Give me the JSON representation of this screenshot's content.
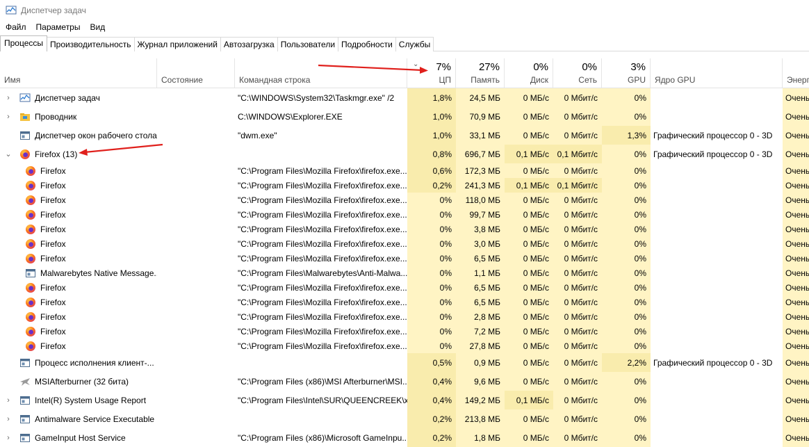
{
  "window": {
    "title": "Диспетчер задач"
  },
  "menu": [
    "Файл",
    "Параметры",
    "Вид"
  ],
  "tabs": [
    "Процессы",
    "Производительность",
    "Журнал приложений",
    "Автозагрузка",
    "Пользователи",
    "Подробности",
    "Службы"
  ],
  "header": {
    "name": "Имя",
    "state": "Состояние",
    "cmd": "Командная строка",
    "cpu_pct": "7%",
    "cpu": "ЦП",
    "mem_pct": "27%",
    "mem": "Память",
    "disk_pct": "0%",
    "disk": "Диск",
    "net_pct": "0%",
    "net": "Сеть",
    "gpu_pct": "3%",
    "gpu": "GPU",
    "engine": "Ядро GPU",
    "power": "Энерг"
  },
  "rows": [
    {
      "exp": "›",
      "icon": "taskmgr-icon",
      "name": "Диспетчер задач",
      "cmd": "\"C:\\WINDOWS\\System32\\Taskmgr.exe\" /2",
      "cpu": "1,8%",
      "mem": "24,5 МБ",
      "disk": "0 МБ/с",
      "net": "0 Мбит/с",
      "gpu": "0%",
      "engine": "",
      "power": "Очень"
    },
    {
      "exp": "›",
      "icon": "explorer-icon",
      "name": "Проводник",
      "cmd": "C:\\WINDOWS\\Explorer.EXE",
      "cpu": "1,0%",
      "mem": "70,9 МБ",
      "disk": "0 МБ/с",
      "net": "0 Мбит/с",
      "gpu": "0%",
      "engine": "",
      "power": "Очень"
    },
    {
      "exp": "",
      "icon": "window-icon",
      "name": "Диспетчер окон рабочего стола",
      "cmd": "\"dwm.exe\"",
      "cpu": "1,0%",
      "mem": "33,1 МБ",
      "disk": "0 МБ/с",
      "net": "0 Мбит/с",
      "gpu": "1,3%",
      "engine": "Графический процессор 0 - 3D",
      "power": "Очень"
    },
    {
      "exp": "⌄",
      "icon": "firefox-icon",
      "name": "Firefox (13)",
      "cmd": "",
      "cpu": "0,8%",
      "mem": "696,7 МБ",
      "disk": "0,1 МБ/с",
      "net": "0,1 Мбит/с",
      "gpu": "0%",
      "engine": "Графический процессор 0 - 3D",
      "power": "Очень"
    },
    {
      "child": true,
      "icon": "firefox-icon",
      "name": "Firefox",
      "cmd": "\"C:\\Program Files\\Mozilla Firefox\\firefox.exe...",
      "cpu": "0,6%",
      "mem": "172,3 МБ",
      "disk": "0 МБ/с",
      "net": "0 Мбит/с",
      "gpu": "0%",
      "engine": "",
      "power": "Очень"
    },
    {
      "child": true,
      "icon": "firefox-icon",
      "name": "Firefox",
      "cmd": "\"C:\\Program Files\\Mozilla Firefox\\firefox.exe...",
      "cpu": "0,2%",
      "mem": "241,3 МБ",
      "disk": "0,1 МБ/с",
      "net": "0,1 Мбит/с",
      "gpu": "0%",
      "engine": "",
      "power": "Очень"
    },
    {
      "child": true,
      "icon": "firefox-icon",
      "name": "Firefox",
      "cmd": "\"C:\\Program Files\\Mozilla Firefox\\firefox.exe...",
      "cpu": "0%",
      "mem": "118,0 МБ",
      "disk": "0 МБ/с",
      "net": "0 Мбит/с",
      "gpu": "0%",
      "engine": "",
      "power": "Очень"
    },
    {
      "child": true,
      "icon": "firefox-icon",
      "name": "Firefox",
      "cmd": "\"C:\\Program Files\\Mozilla Firefox\\firefox.exe...",
      "cpu": "0%",
      "mem": "99,7 МБ",
      "disk": "0 МБ/с",
      "net": "0 Мбит/с",
      "gpu": "0%",
      "engine": "",
      "power": "Очень"
    },
    {
      "child": true,
      "icon": "firefox-icon",
      "name": "Firefox",
      "cmd": "\"C:\\Program Files\\Mozilla Firefox\\firefox.exe...",
      "cpu": "0%",
      "mem": "3,8 МБ",
      "disk": "0 МБ/с",
      "net": "0 Мбит/с",
      "gpu": "0%",
      "engine": "",
      "power": "Очень"
    },
    {
      "child": true,
      "icon": "firefox-icon",
      "name": "Firefox",
      "cmd": "\"C:\\Program Files\\Mozilla Firefox\\firefox.exe...",
      "cpu": "0%",
      "mem": "3,0 МБ",
      "disk": "0 МБ/с",
      "net": "0 Мбит/с",
      "gpu": "0%",
      "engine": "",
      "power": "Очень"
    },
    {
      "child": true,
      "icon": "firefox-icon",
      "name": "Firefox",
      "cmd": "\"C:\\Program Files\\Mozilla Firefox\\firefox.exe...",
      "cpu": "0%",
      "mem": "6,5 МБ",
      "disk": "0 МБ/с",
      "net": "0 Мбит/с",
      "gpu": "0%",
      "engine": "",
      "power": "Очень"
    },
    {
      "child": true,
      "icon": "window-icon",
      "name": "Malwarebytes Native Message...",
      "cmd": "\"C:\\Program Files\\Malwarebytes\\Anti-Malwa...",
      "cpu": "0%",
      "mem": "1,1 МБ",
      "disk": "0 МБ/с",
      "net": "0 Мбит/с",
      "gpu": "0%",
      "engine": "",
      "power": "Очень"
    },
    {
      "child": true,
      "icon": "firefox-icon",
      "name": "Firefox",
      "cmd": "\"C:\\Program Files\\Mozilla Firefox\\firefox.exe...",
      "cpu": "0%",
      "mem": "6,5 МБ",
      "disk": "0 МБ/с",
      "net": "0 Мбит/с",
      "gpu": "0%",
      "engine": "",
      "power": "Очень"
    },
    {
      "child": true,
      "icon": "firefox-icon",
      "name": "Firefox",
      "cmd": "\"C:\\Program Files\\Mozilla Firefox\\firefox.exe...",
      "cpu": "0%",
      "mem": "6,5 МБ",
      "disk": "0 МБ/с",
      "net": "0 Мбит/с",
      "gpu": "0%",
      "engine": "",
      "power": "Очень"
    },
    {
      "child": true,
      "icon": "firefox-icon",
      "name": "Firefox",
      "cmd": "\"C:\\Program Files\\Mozilla Firefox\\firefox.exe...",
      "cpu": "0%",
      "mem": "2,8 МБ",
      "disk": "0 МБ/с",
      "net": "0 Мбит/с",
      "gpu": "0%",
      "engine": "",
      "power": "Очень"
    },
    {
      "child": true,
      "icon": "firefox-icon",
      "name": "Firefox",
      "cmd": "\"C:\\Program Files\\Mozilla Firefox\\firefox.exe...",
      "cpu": "0%",
      "mem": "7,2 МБ",
      "disk": "0 МБ/с",
      "net": "0 Мбит/с",
      "gpu": "0%",
      "engine": "",
      "power": "Очень"
    },
    {
      "child": true,
      "icon": "firefox-icon",
      "name": "Firefox",
      "cmd": "\"C:\\Program Files\\Mozilla Firefox\\firefox.exe...",
      "cpu": "0%",
      "mem": "27,8 МБ",
      "disk": "0 МБ/с",
      "net": "0 Мбит/с",
      "gpu": "0%",
      "engine": "",
      "power": "Очень"
    },
    {
      "exp": "",
      "icon": "window-icon",
      "name": "Процесс исполнения клиент-...",
      "cmd": "",
      "cpu": "0,5%",
      "mem": "0,9 МБ",
      "disk": "0 МБ/с",
      "net": "0 Мбит/с",
      "gpu": "2,2%",
      "engine": "Графический процессор 0 - 3D",
      "power": "Очень"
    },
    {
      "exp": "",
      "icon": "plane-icon",
      "name": "MSIAfterburner (32 бита)",
      "cmd": "\"C:\\Program Files (x86)\\MSI Afterburner\\MSI...",
      "cpu": "0,4%",
      "mem": "9,6 МБ",
      "disk": "0 МБ/с",
      "net": "0 Мбит/с",
      "gpu": "0%",
      "engine": "",
      "power": "Очень"
    },
    {
      "exp": "›",
      "icon": "window-icon",
      "name": "Intel(R) System Usage Report",
      "cmd": "\"C:\\Program Files\\Intel\\SUR\\QUEENCREEK\\x...",
      "cpu": "0,4%",
      "mem": "149,2 МБ",
      "disk": "0,1 МБ/с",
      "net": "0 Мбит/с",
      "gpu": "0%",
      "engine": "",
      "power": "Очень"
    },
    {
      "exp": "›",
      "icon": "window-icon",
      "name": "Antimalware Service Executable",
      "cmd": "",
      "cpu": "0,2%",
      "mem": "213,8 МБ",
      "disk": "0 МБ/с",
      "net": "0 Мбит/с",
      "gpu": "0%",
      "engine": "",
      "power": "Очень"
    },
    {
      "exp": "›",
      "icon": "window-icon",
      "name": "GameInput Host Service",
      "cmd": "\"C:\\Program Files (x86)\\Microsoft GameInpu...",
      "cpu": "0,2%",
      "mem": "1,8 МБ",
      "disk": "0 МБ/с",
      "net": "0 Мбит/с",
      "gpu": "0%",
      "engine": "",
      "power": "Очень"
    }
  ]
}
